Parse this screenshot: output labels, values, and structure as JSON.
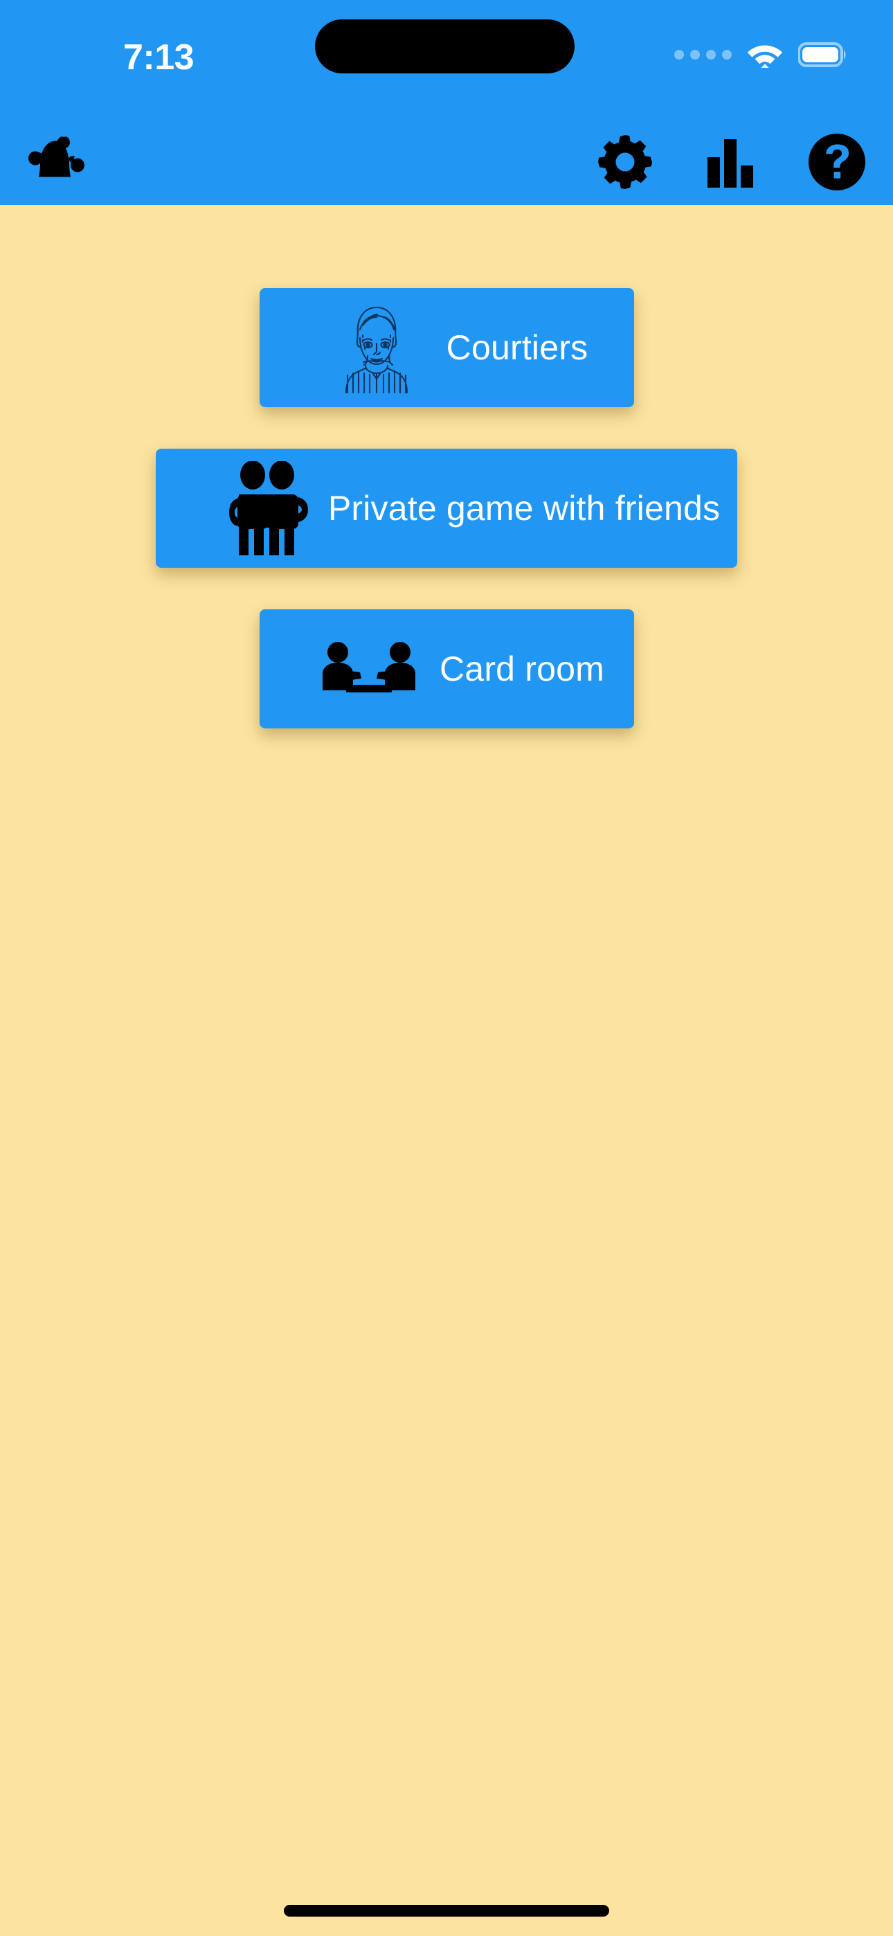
{
  "theme": {
    "accent_blue": "#2196F3",
    "background_cream": "#FCE3A0",
    "icon_black": "#000000",
    "text_white": "#FFFFFF",
    "portrait_navy": "#153A6B"
  },
  "status_bar": {
    "time": "7:13",
    "signal_icon": "signal-dots-icon",
    "wifi_icon": "wifi-icon",
    "battery_icon": "battery-icon",
    "dynamic_island": "dynamic-island"
  },
  "app_bar": {
    "logo_icon": "jester-hat-icon",
    "actions": [
      {
        "name": "settings",
        "icon": "gear-icon"
      },
      {
        "name": "statistics",
        "icon": "bar-chart-icon"
      },
      {
        "name": "help",
        "icon": "question-mark-circle-icon"
      }
    ]
  },
  "main_menu": {
    "buttons": [
      {
        "label": "Courtiers",
        "icon": "portrait-face-icon"
      },
      {
        "label": "Private game with friends",
        "icon": "two-people-icon"
      },
      {
        "label": "Card room",
        "icon": "players-at-table-icon"
      }
    ]
  },
  "home_indicator": "home-indicator-bar"
}
